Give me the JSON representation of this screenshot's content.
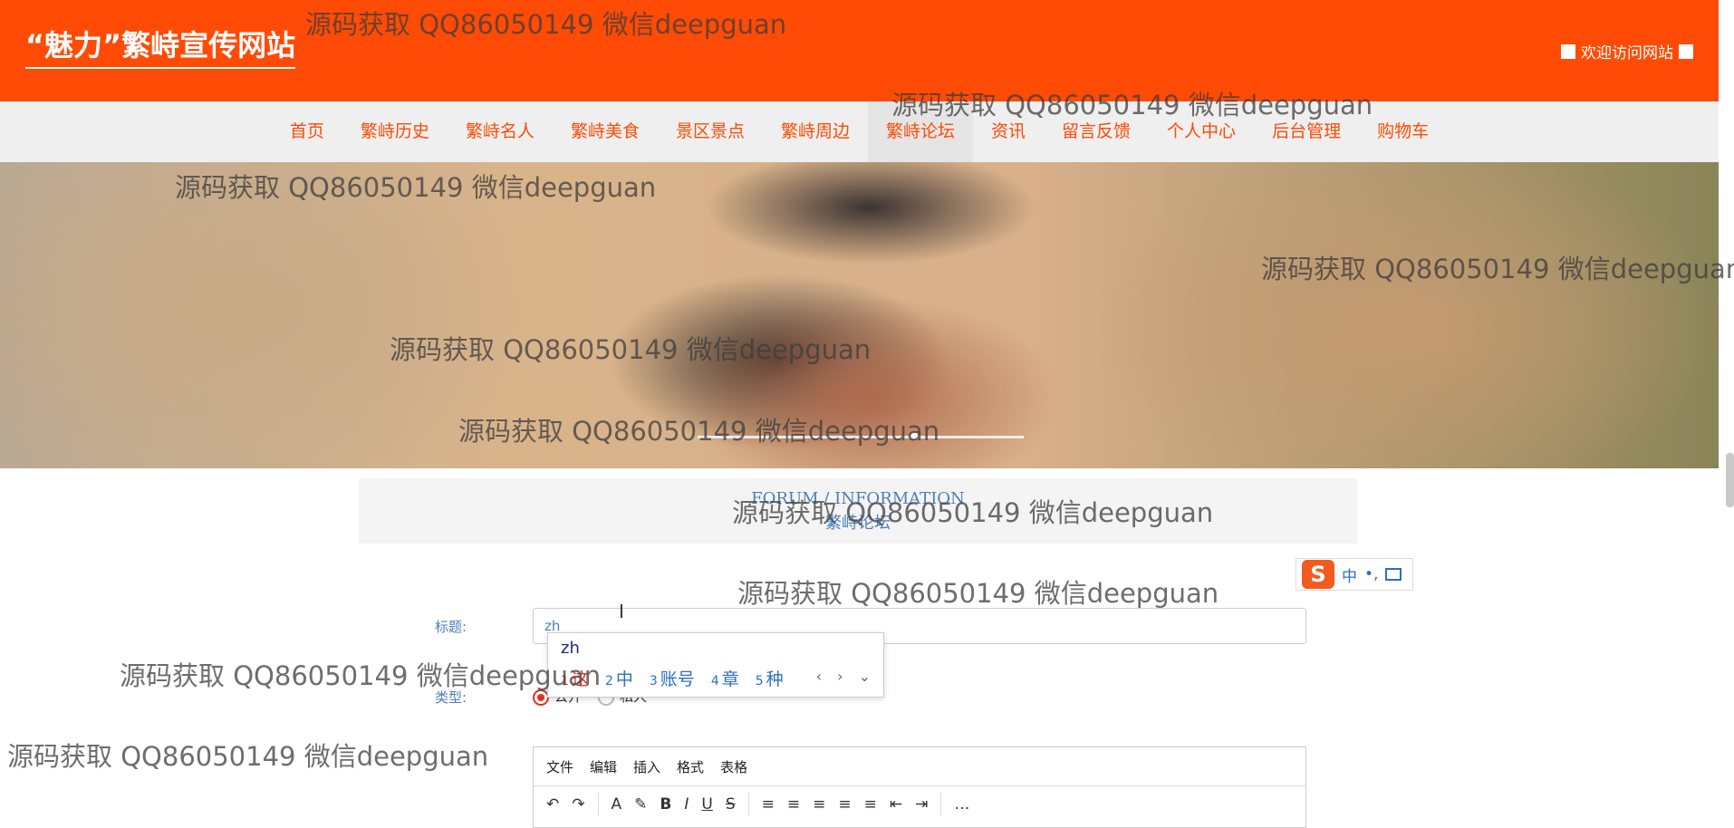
{
  "header": {
    "site_title": "“魅力”繁峙宣传网站",
    "welcome": "欢迎访问网站"
  },
  "nav": {
    "items": [
      {
        "label": "首页"
      },
      {
        "label": "繁峙历史"
      },
      {
        "label": "繁峙名人"
      },
      {
        "label": "繁峙美食"
      },
      {
        "label": "景区景点"
      },
      {
        "label": "繁峙周边"
      },
      {
        "label": "繁峙论坛",
        "active": true
      },
      {
        "label": "资讯"
      },
      {
        "label": "留言反馈"
      },
      {
        "label": "个人中心"
      },
      {
        "label": "后台管理"
      },
      {
        "label": "购物车"
      }
    ]
  },
  "section": {
    "en_title": "FORUM / INFORMATION",
    "cn_title": "繁峙论坛"
  },
  "form": {
    "title_label": "标题:",
    "title_value": "zh",
    "type_label": "类型:",
    "type_options": [
      "公开",
      "私人"
    ],
    "type_selected": "公开"
  },
  "ime": {
    "composition": "zh",
    "candidates": [
      {
        "index": "1",
        "text": "这"
      },
      {
        "index": "2",
        "text": "中"
      },
      {
        "index": "3",
        "text": "账号"
      },
      {
        "index": "4",
        "text": "章"
      },
      {
        "index": "5",
        "text": "种"
      }
    ],
    "toolbar_logo": "S",
    "toolbar_mode": "中",
    "toolbar_punct": "•,"
  },
  "editor": {
    "menu": [
      "文件",
      "编辑",
      "插入",
      "格式",
      "表格"
    ],
    "tools": [
      "↶",
      "↷",
      "A",
      "✎",
      "B",
      "I",
      "U",
      "S",
      "≡",
      "≡",
      "≡",
      "≡",
      "≡",
      "⇤",
      "⇥",
      "…"
    ]
  },
  "watermark": "源码获取 QQ86050149 微信deepguan",
  "colors": {
    "brand": "#ff4b05",
    "link": "#4b7fbd",
    "accent_red": "#e0311f"
  }
}
